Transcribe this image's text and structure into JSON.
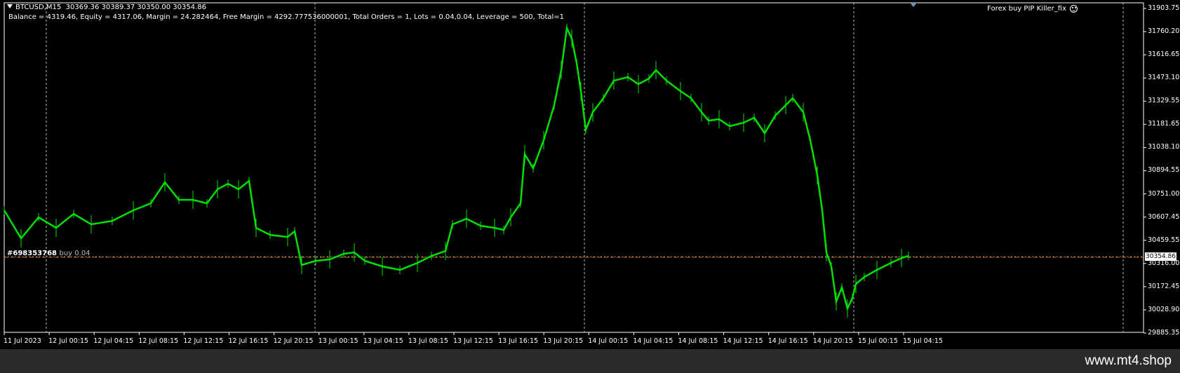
{
  "chart": {
    "symbol": "BTCUSD,M15",
    "ohlc": "30369.36 30389.37 30350.00 30354.86",
    "account_info": "Balance = 4319.46, Equity = 4317.06, Margin = 24.282464, Free Margin = 4292.777536000001, Total Orders = 1, Lots = 0.04,0.04, Leverage = 500, Total=1",
    "ea_name": "Forex  buy PIP Killer_fix",
    "order_ticket": "#698353768",
    "order_type": "buy 0.04",
    "current_price": "30354.86",
    "y_ticks": [
      "31903.75",
      "31760.20",
      "31616.65",
      "31473.10",
      "31329.55",
      "31181.65",
      "31038.10",
      "30894.55",
      "30751.00",
      "30607.45",
      "30459.55",
      "30316.00",
      "30172.45",
      "30028.90",
      "29885.35"
    ],
    "x_ticks": [
      "11 Jul 2023",
      "12 Jul 00:15",
      "12 Jul 04:15",
      "12 Jul 08:15",
      "12 Jul 12:15",
      "12 Jul 16:15",
      "12 Jul 20:15",
      "13 Jul 00:15",
      "13 Jul 04:15",
      "13 Jul 08:15",
      "13 Jul 12:15",
      "13 Jul 16:15",
      "13 Jul 20:15",
      "14 Jul 00:15",
      "14 Jul 04:15",
      "14 Jul 08:15",
      "14 Jul 12:15",
      "14 Jul 16:15",
      "14 Jul 20:15",
      "15 Jul 00:15",
      "15 Jul 04:15"
    ]
  },
  "colors": {
    "candle": "#00e000",
    "order_line": "#c8641e",
    "grid": "#c0c0c0",
    "background": "#000000"
  },
  "footer": {
    "watermark": "www.mt4.shop"
  }
}
